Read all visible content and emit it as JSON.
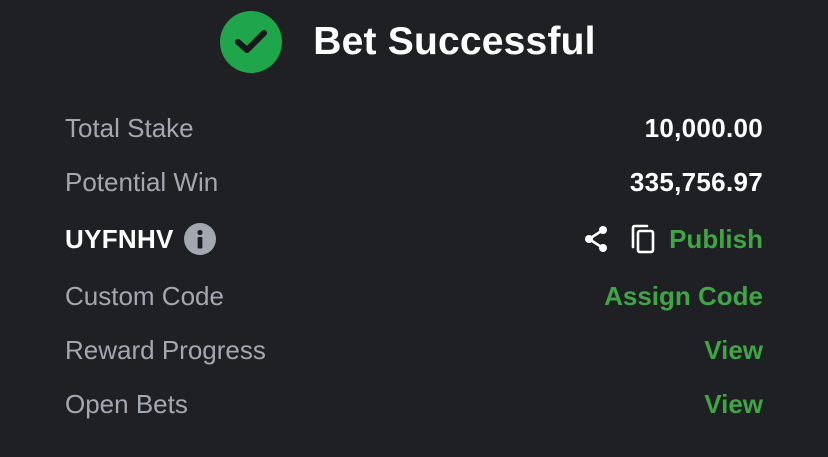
{
  "header": {
    "title": "Bet Successful",
    "icon": "check-circle-icon",
    "accent_color": "#1fa64a"
  },
  "rows": {
    "total_stake": {
      "label": "Total Stake",
      "value": "10,000.00"
    },
    "potential_win": {
      "label": "Potential Win",
      "value": "335,756.97"
    },
    "booking": {
      "code": "UYFNHV",
      "info_icon": "info-icon",
      "share_icon": "share-icon",
      "copy_icon": "copy-icon",
      "publish_label": "Publish"
    },
    "custom_code": {
      "label": "Custom Code",
      "action": "Assign Code"
    },
    "reward_progress": {
      "label": "Reward Progress",
      "action": "View"
    },
    "open_bets": {
      "label": "Open Bets",
      "action": "View"
    }
  },
  "colors": {
    "background": "#1f2024",
    "link": "#3fa545",
    "muted_text": "#a3a7b0",
    "primary_text": "#ffffff"
  }
}
